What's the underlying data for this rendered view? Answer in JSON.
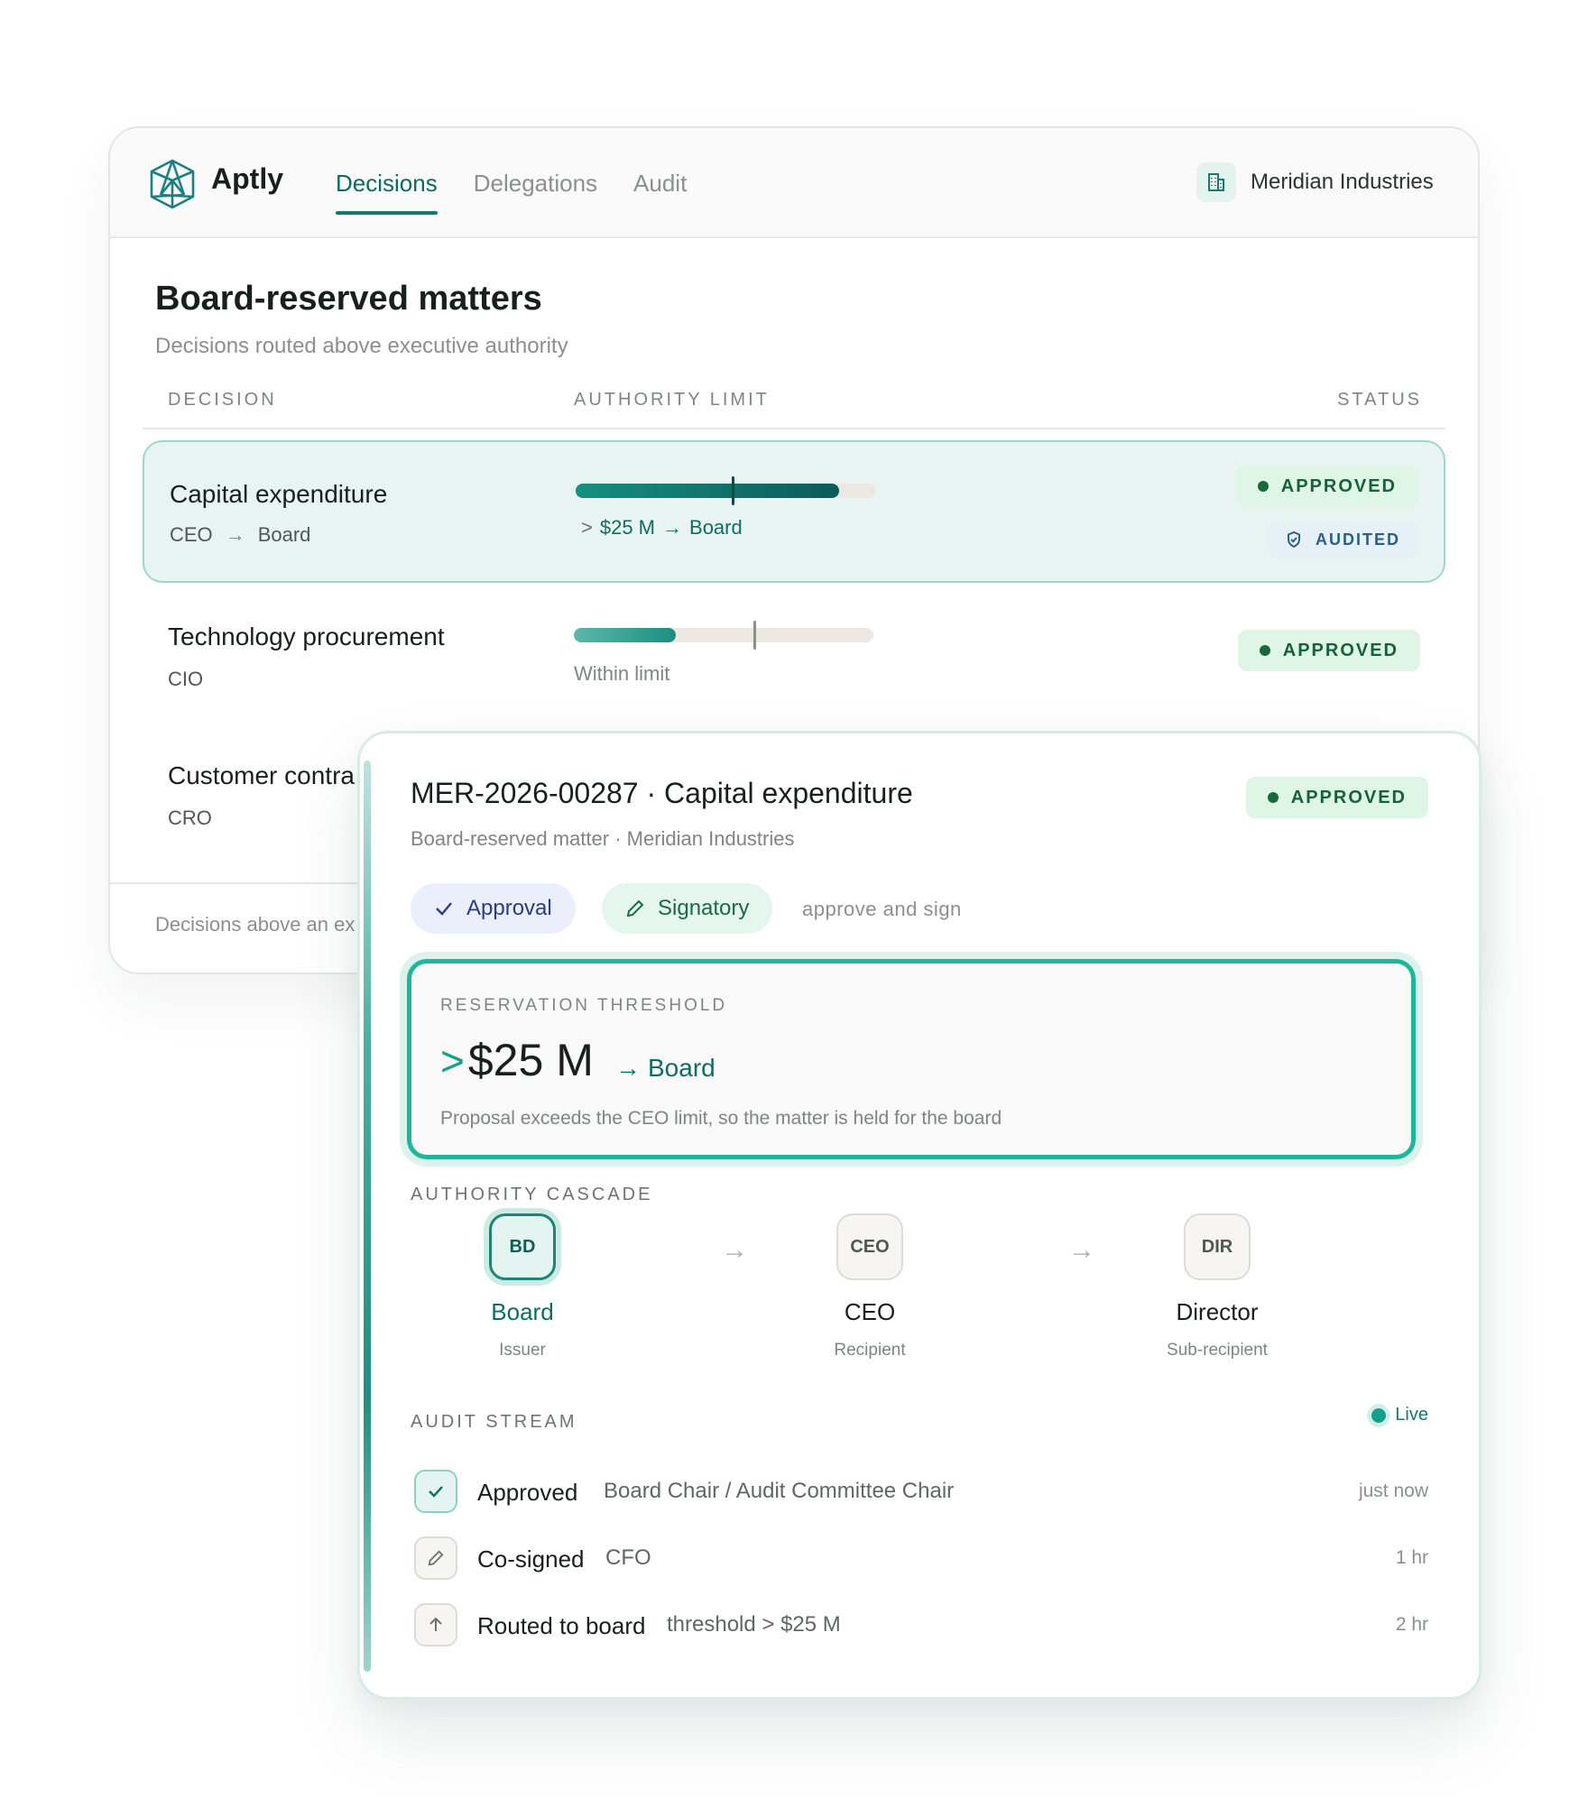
{
  "app": {
    "brand": "Aptly",
    "nav": [
      "Decisions",
      "Delegations",
      "Audit"
    ],
    "active_nav": "Decisions",
    "org_name": "Meridian Industries",
    "icons": {
      "logo": "geodesic-sphere-logo",
      "org": "building-icon"
    }
  },
  "page": {
    "title": "Board-reserved matters",
    "subtitle": "Decisions routed above executive authority",
    "columns": {
      "decision": "DECISION",
      "limit": "AUTHORITY LIMIT",
      "status": "STATUS"
    }
  },
  "rows": [
    {
      "title": "Capital expenditure",
      "from": "CEO",
      "to": "Board",
      "limit_prefix": ">",
      "limit_amount": "$25 M",
      "limit_target": "Board",
      "fill_fraction": 0.88,
      "tick_fraction": 0.52,
      "status": "APPROVED",
      "badge": "AUDITED"
    },
    {
      "title": "Technology procurement",
      "from": "CIO",
      "limit_label": "Within limit",
      "fill_fraction": 0.34,
      "tick_fraction": 0.6,
      "status": "APPROVED"
    },
    {
      "title": "Customer contra",
      "from": "CRO"
    }
  ],
  "footer": {
    "text": "Decisions above an ex"
  },
  "detail": {
    "title": "MER-2026-00287 · Capital expenditure",
    "subtitle": "Board-reserved matter · Meridian Industries",
    "status": "APPROVED",
    "chips": {
      "approval": "Approval",
      "signatory": "Signatory",
      "note": "approve and sign"
    },
    "threshold": {
      "label": "RESERVATION THRESHOLD",
      "prefix": ">",
      "amount": "$25 M",
      "target": "Board",
      "note": "Proposal exceeds the CEO limit, so the matter is held for the board"
    },
    "cascade": {
      "label": "AUTHORITY CASCADE",
      "nodes": [
        {
          "abbr": "BD",
          "name": "Board",
          "role": "Issuer"
        },
        {
          "abbr": "CEO",
          "name": "CEO",
          "role": "Recipient"
        },
        {
          "abbr": "DIR",
          "name": "Director",
          "role": "Sub-recipient"
        }
      ]
    },
    "audit": {
      "label": "AUDIT STREAM",
      "live": "Live",
      "events": [
        {
          "title": "Approved",
          "actor": "Board Chair / Audit Committee Chair",
          "time": "just now",
          "icon": "check-icon"
        },
        {
          "title": "Co-signed",
          "actor": "CFO",
          "time": "1 hr",
          "icon": "pencil-icon"
        },
        {
          "title": "Routed to board",
          "actor": "threshold > $25 M",
          "time": "2 hr",
          "icon": "arrow-up-icon"
        }
      ]
    }
  },
  "colors": {
    "accent": "#0f7b71",
    "highlight_bg": "#e8f4f1",
    "approved_bg": "#dff5e6",
    "approved_text": "#16613a",
    "threshold_border": "#1db89a"
  }
}
